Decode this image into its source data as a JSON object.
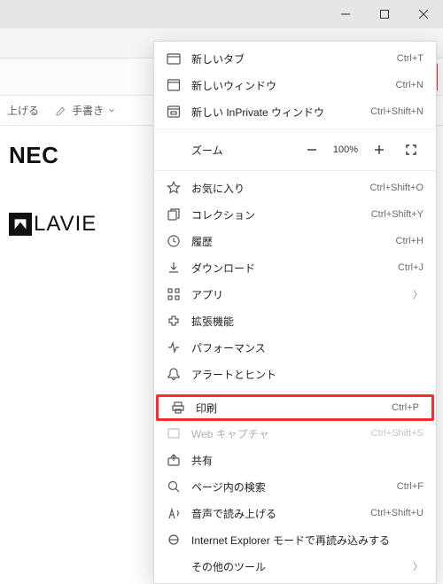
{
  "window": {
    "minimize": "−",
    "maximize": "□",
    "close": "✕"
  },
  "contentbar": {
    "readaloud": "上げる",
    "draw": "手書き"
  },
  "page": {
    "nec": "NEC",
    "lavie": "LAVIE"
  },
  "menu": {
    "new_tab": {
      "label": "新しいタブ",
      "shortcut": "Ctrl+T"
    },
    "new_window": {
      "label": "新しいウィンドウ",
      "shortcut": "Ctrl+N"
    },
    "new_inprivate": {
      "label": "新しい InPrivate ウィンドウ",
      "shortcut": "Ctrl+Shift+N"
    },
    "zoom": {
      "label": "ズーム",
      "value": "100%"
    },
    "favorites": {
      "label": "お気に入り",
      "shortcut": "Ctrl+Shift+O"
    },
    "collections": {
      "label": "コレクション",
      "shortcut": "Ctrl+Shift+Y"
    },
    "history": {
      "label": "履歴",
      "shortcut": "Ctrl+H"
    },
    "downloads": {
      "label": "ダウンロード",
      "shortcut": "Ctrl+J"
    },
    "apps": {
      "label": "アプリ"
    },
    "extensions": {
      "label": "拡張機能"
    },
    "performance": {
      "label": "パフォーマンス"
    },
    "alerts": {
      "label": "アラートとヒント"
    },
    "print": {
      "label": "印刷",
      "shortcut": "Ctrl+P"
    },
    "webcapture": {
      "label": "Web キャプチャ",
      "shortcut": "Ctrl+Shift+S"
    },
    "share": {
      "label": "共有"
    },
    "find": {
      "label": "ページ内の検索",
      "shortcut": "Ctrl+F"
    },
    "readaloud": {
      "label": "音声で読み上げる",
      "shortcut": "Ctrl+Shift+U"
    },
    "ie_mode": {
      "label": "Internet Explorer モードで再読み込みする"
    },
    "more_tools": {
      "label": "その他のツール"
    }
  }
}
